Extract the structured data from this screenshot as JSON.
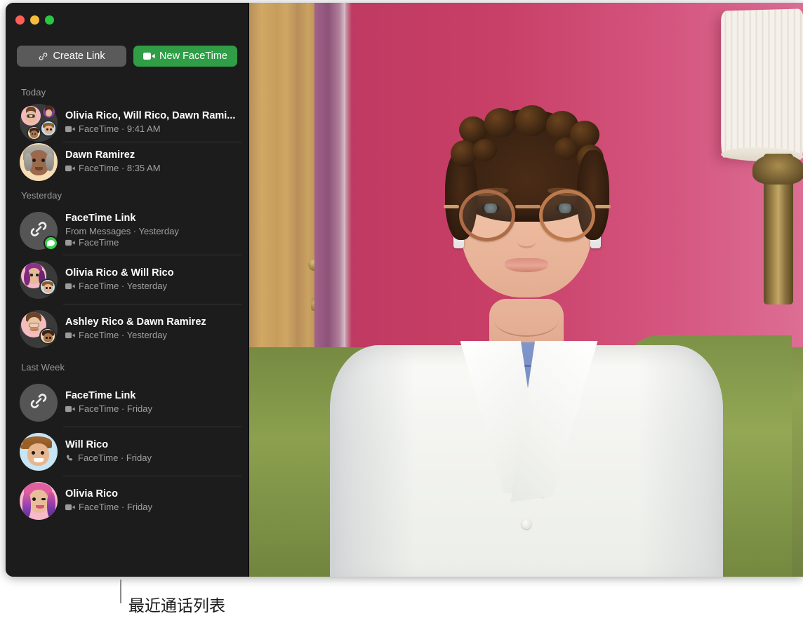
{
  "window": {
    "traffic_lights": [
      {
        "name": "close",
        "color": "#ff5f57"
      },
      {
        "name": "minimize",
        "color": "#f6bd3b"
      },
      {
        "name": "maximize",
        "color": "#28c840"
      }
    ]
  },
  "toolbar": {
    "create_link_label": "Create Link",
    "create_link_icon": "link-icon",
    "new_facetime_label": "New FaceTime",
    "new_facetime_icon": "video-camera-icon",
    "new_facetime_color": "#2f9e46"
  },
  "sidebar": {
    "sections": [
      {
        "header": "Today",
        "items": [
          {
            "title": "Olivia Rico, Will Rico, Dawn Rami...",
            "subtitle": "FaceTime · 9:41 AM",
            "sub_icon": "video-camera-icon",
            "avatar": "group-4-memoji",
            "from_line": null,
            "badge": null
          },
          {
            "title": "Dawn Ramirez",
            "subtitle": "FaceTime · 8:35 AM",
            "sub_icon": "video-camera-icon",
            "avatar": "memoji-dawn",
            "from_line": null,
            "badge": null
          }
        ]
      },
      {
        "header": "Yesterday",
        "items": [
          {
            "title": "FaceTime Link",
            "from_line": "From Messages · Yesterday",
            "subtitle": "FaceTime",
            "sub_icon": "video-camera-icon",
            "avatar": "link-icon",
            "badge": "messages-badge"
          },
          {
            "title": "Olivia Rico & Will Rico",
            "subtitle": "FaceTime · Yesterday",
            "sub_icon": "video-camera-icon",
            "avatar": "pair-olivia-will",
            "from_line": null,
            "badge": null
          },
          {
            "title": "Ashley Rico & Dawn Ramirez",
            "subtitle": "FaceTime · Yesterday",
            "sub_icon": "video-camera-icon",
            "avatar": "pair-ashley-dawn",
            "from_line": null,
            "badge": null
          }
        ]
      },
      {
        "header": "Last Week",
        "items": [
          {
            "title": "FaceTime Link",
            "subtitle": "FaceTime · Friday",
            "sub_icon": "video-camera-icon",
            "avatar": "link-icon",
            "from_line": null,
            "badge": null
          },
          {
            "title": "Will Rico",
            "subtitle": "FaceTime · Friday",
            "sub_icon": "phone-icon",
            "avatar": "memoji-will",
            "from_line": null,
            "badge": null
          },
          {
            "title": "Olivia Rico",
            "subtitle": "FaceTime · Friday",
            "sub_icon": "video-camera-icon",
            "avatar": "memoji-olivia",
            "from_line": null,
            "badge": null
          }
        ]
      }
    ]
  },
  "video": {
    "description": "live-video-feed"
  },
  "callout": {
    "label": "最近通话列表"
  }
}
